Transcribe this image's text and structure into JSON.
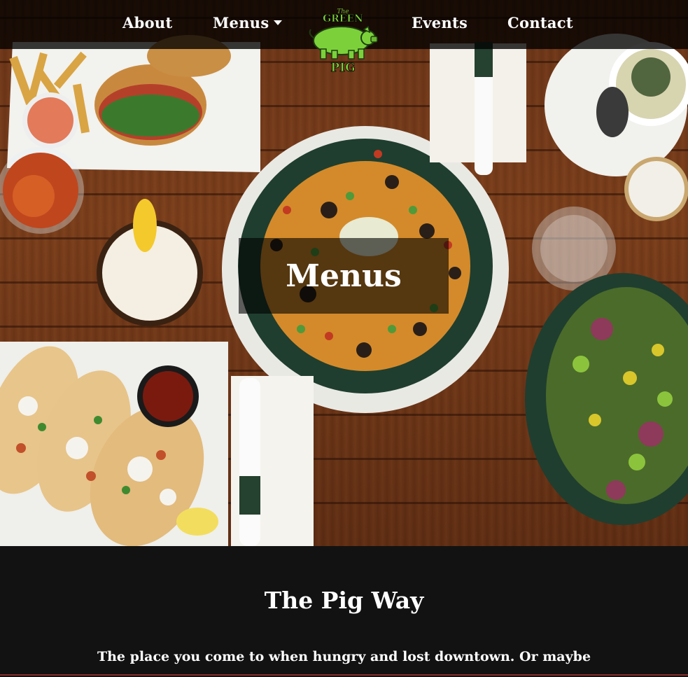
{
  "nav": {
    "items": [
      {
        "label": "About"
      },
      {
        "label": "Menus"
      },
      {
        "label": "Events"
      },
      {
        "label": "Contact"
      }
    ],
    "logo": {
      "top_text": "The",
      "mid_text": "GREEN",
      "bottom_text": "PIG",
      "pig_color": "#7cd13a"
    }
  },
  "hero": {
    "title": "Menus"
  },
  "about": {
    "heading": "The Pig Way",
    "intro": "The place you come to when hungry and lost downtown. Or maybe"
  },
  "colors": {
    "nav_bg": "#000000",
    "section_bg": "#121212",
    "logo_green": "#7cd13a",
    "wood": "#6b3417"
  }
}
